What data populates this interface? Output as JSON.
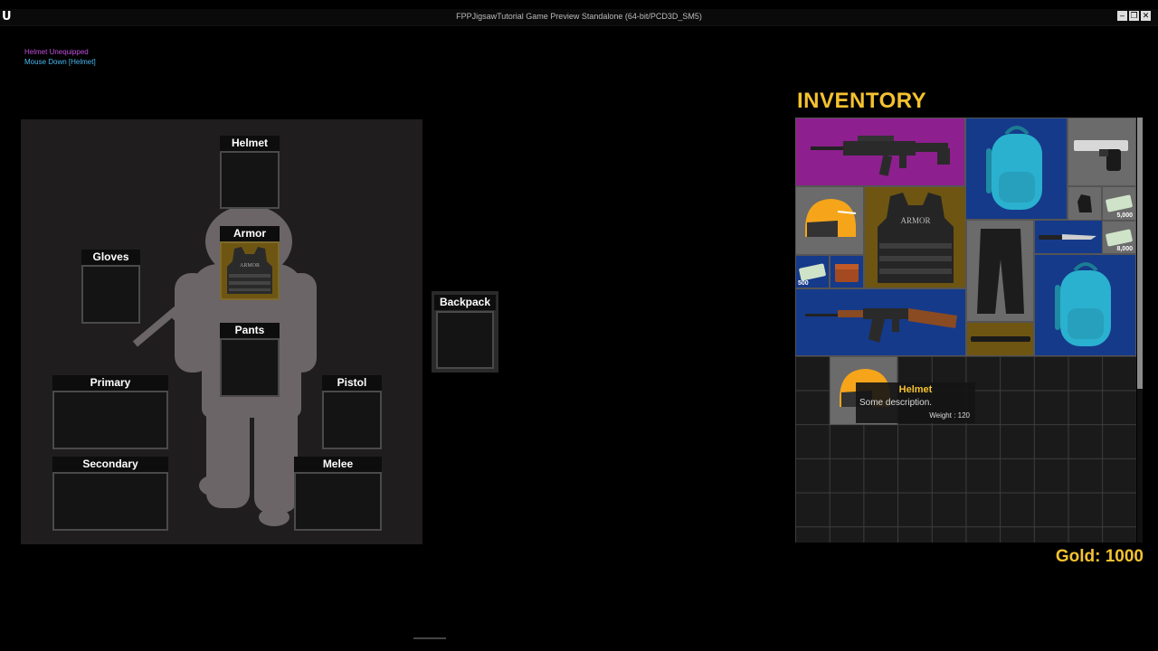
{
  "window": {
    "title": "FPPJigsawTutorial Game Preview Standalone (64-bit/PCD3D_SM5)",
    "logo": "U",
    "buttons": [
      "minimize-icon",
      "restore-icon",
      "close-icon"
    ]
  },
  "log": {
    "line1": "Helmet Unequipped",
    "line2": "Mouse Down [Helmet]"
  },
  "equipment": {
    "helmet": "Helmet",
    "armor": "Armor",
    "gloves": "Gloves",
    "pants": "Pants",
    "primary": "Primary",
    "pistol": "Pistol",
    "secondary": "Secondary",
    "melee": "Melee",
    "backpack": "Backpack",
    "armor_item_text": "ARMOR"
  },
  "inventory": {
    "title": "INVENTORY",
    "armor_item_text": "ARMOR",
    "money": [
      "5,000",
      "8,000",
      "500"
    ],
    "tooltip": {
      "name": "Helmet",
      "description": "Some description.",
      "weight": "Weight : 120"
    }
  },
  "gold": "Gold: 1000",
  "colors": {
    "accent": "#f4c230",
    "rare_purple": "#8e1f8e",
    "blue": "#153a8a",
    "gold_bg": "#6e5512",
    "grey": "#6b6b6b"
  }
}
